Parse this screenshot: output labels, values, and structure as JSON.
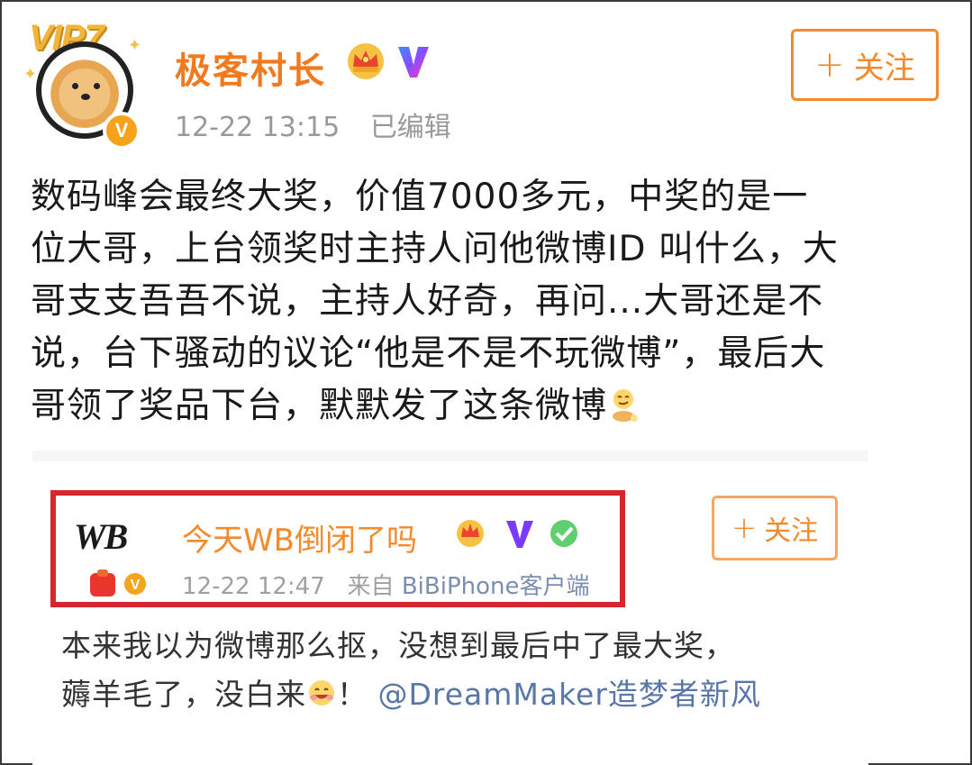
{
  "header": {
    "vip_label": "VIP7",
    "username": "极客村长",
    "timestamp": "12-22 13:15",
    "edited_label": "已编辑",
    "follow_label": "关注",
    "icons": [
      "vip-badge-icon",
      "crown-icon",
      "v-logo-icon",
      "verified-badge-icon"
    ],
    "colors": {
      "username": "#f27a1e",
      "follow": "#f08a2c",
      "meta": "#999999"
    }
  },
  "post": {
    "lines": [
      "数码峰会最终大奖，价值7000多元，中奖的是一",
      "位大哥，上台领奖时主持人问他微博ID 叫什么，大",
      "哥支支吾吾不说，主持人好奇，再问...大哥还是不",
      "说，台下骚动的议论“他是不是不玩微博”，最后大",
      "哥领了奖品下台，默默发了这条微博"
    ],
    "trailing_emoji": "smirk-emoji-icon"
  },
  "embed": {
    "logo_text": "WB",
    "username": "今天WB倒闭了吗",
    "timestamp": "12-22 12:47",
    "source_prefix": "来自",
    "source": "BiBiPhone客户端",
    "follow_label": "关注",
    "text_line1": "本来我以为微博那么抠，没想到最后中了最大奖，",
    "text_line2_prefix": "薅羊毛了，没白来",
    "text_line2_suffix": "！",
    "mention": "@DreamMaker造梦者新风",
    "highlight_color": "#d8262d"
  }
}
